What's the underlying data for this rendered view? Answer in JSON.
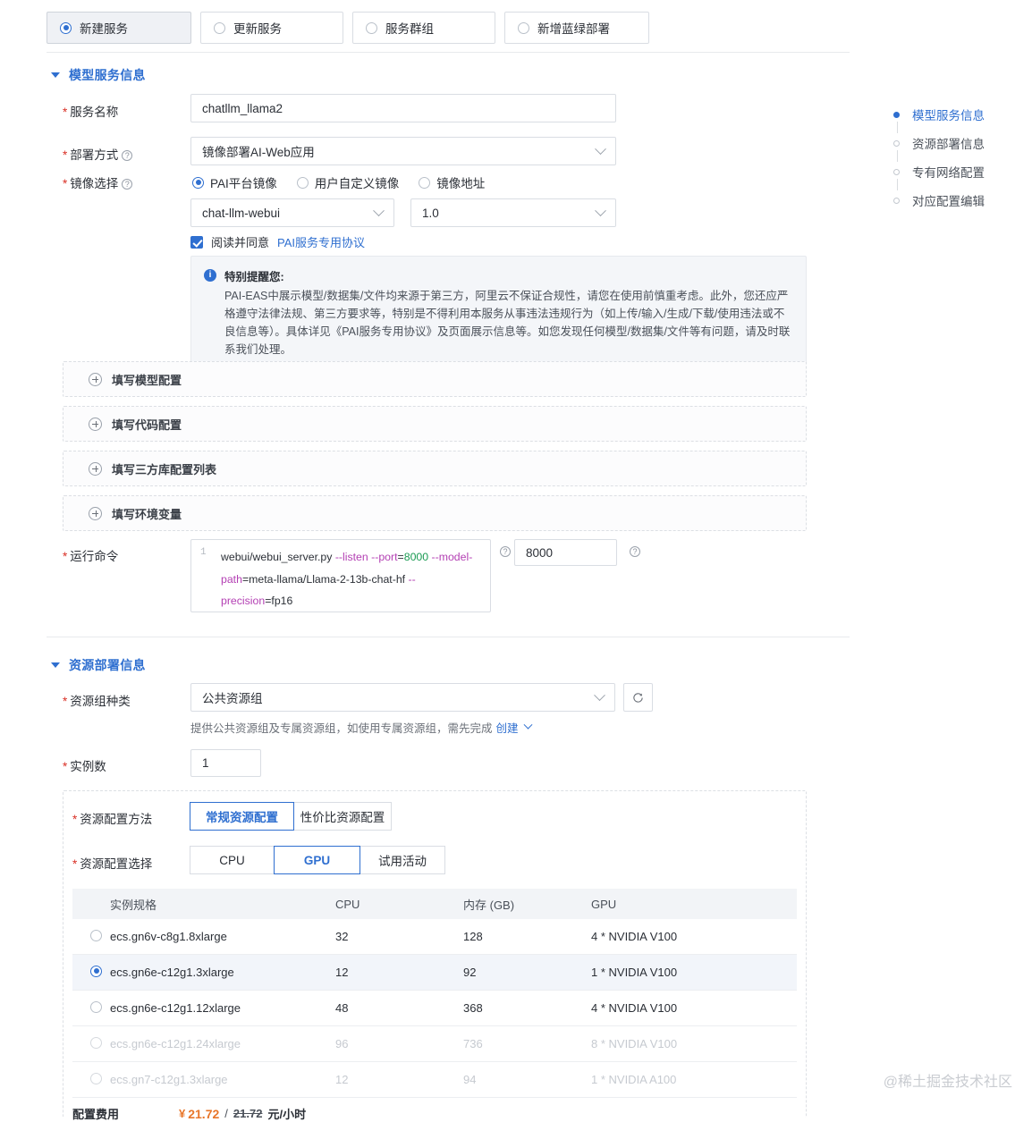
{
  "mode_options": [
    {
      "label": "新建服务",
      "selected": true
    },
    {
      "label": "更新服务",
      "selected": false
    },
    {
      "label": "服务群组",
      "selected": false
    },
    {
      "label": "新增蓝绿部署",
      "selected": false
    }
  ],
  "sections": {
    "model_service": {
      "title": "模型服务信息"
    },
    "resource_deploy": {
      "title": "资源部署信息"
    }
  },
  "form": {
    "service_name": {
      "label": "服务名称",
      "value": "chatllm_llama2"
    },
    "deploy_method": {
      "label": "部署方式",
      "value": "镜像部署AI-Web应用"
    },
    "image_choice": {
      "label": "镜像选择",
      "options": [
        "PAI平台镜像",
        "用户自定义镜像",
        "镜像地址"
      ],
      "selected_index": 0,
      "image_name": "chat-llm-webui",
      "image_version": "1.0"
    },
    "agreement": {
      "text_prefix": "阅读并同意",
      "link": "PAI服务专用协议",
      "checked": true
    },
    "notice": {
      "title": "特别提醒您:",
      "body": "PAI-EAS中展示模型/数据集/文件均来源于第三方，阿里云不保证合规性，请您在使用前慎重考虑。此外，您还应严格遵守法律法规、第三方要求等，特别是不得利用本服务从事违法违规行为（如上传/输入/生成/下载/使用违法或不良信息等）。具体详见《PAI服务专用协议》及页面展示信息等。如您发现任何模型/数据集/文件等有问题，请及时联系我们处理。"
    },
    "add_rows": [
      {
        "label": "填写模型配置"
      },
      {
        "label": "填写代码配置"
      },
      {
        "label": "填写三方库配置列表"
      },
      {
        "label": "填写环境变量"
      }
    ],
    "run_command": {
      "label": "运行命令",
      "line_number": "1",
      "tokens": [
        {
          "text": "webui/webui_server.py ",
          "type": "plain"
        },
        {
          "text": "--listen ",
          "type": "flag"
        },
        {
          "text": "--port",
          "type": "flag"
        },
        {
          "text": "=",
          "type": "plain"
        },
        {
          "text": "8000",
          "type": "num"
        },
        {
          "text": " ",
          "type": "plain"
        },
        {
          "text": "--model-path",
          "type": "flag"
        },
        {
          "text": "=meta-llama/Llama-2-13b-chat-hf ",
          "type": "plain"
        },
        {
          "text": "--precision",
          "type": "flag"
        },
        {
          "text": "=fp16",
          "type": "plain"
        }
      ],
      "port_value": "8000"
    },
    "resource_group": {
      "label": "资源组种类",
      "value": "公共资源组",
      "hint_prefix": "提供公共资源组及专属资源组，如使用专属资源组，需先完成",
      "hint_link": "创建",
      "refresh_icon": "refresh-icon"
    },
    "instance_count": {
      "label": "实例数",
      "value": "1"
    },
    "config_method": {
      "label": "资源配置方法",
      "options": [
        "常规资源配置",
        "性价比资源配置"
      ],
      "selected_index": 0
    },
    "config_choice": {
      "label": "资源配置选择",
      "options": [
        "CPU",
        "GPU",
        "试用活动"
      ],
      "selected_index": 1
    }
  },
  "table": {
    "columns": [
      "实例规格",
      "CPU",
      "内存 (GB)",
      "GPU"
    ],
    "rows": [
      {
        "spec": "ecs.gn6v-c8g1.8xlarge",
        "cpu": "32",
        "mem": "128",
        "gpu": "4 * NVIDIA V100",
        "selected": false,
        "disabled": false
      },
      {
        "spec": "ecs.gn6e-c12g1.3xlarge",
        "cpu": "12",
        "mem": "92",
        "gpu": "1 * NVIDIA V100",
        "selected": true,
        "disabled": false
      },
      {
        "spec": "ecs.gn6e-c12g1.12xlarge",
        "cpu": "48",
        "mem": "368",
        "gpu": "4 * NVIDIA V100",
        "selected": false,
        "disabled": false
      },
      {
        "spec": "ecs.gn6e-c12g1.24xlarge",
        "cpu": "96",
        "mem": "736",
        "gpu": "8 * NVIDIA V100",
        "selected": false,
        "disabled": true
      },
      {
        "spec": "ecs.gn7-c12g1.3xlarge",
        "cpu": "12",
        "mem": "94",
        "gpu": "1 * NVIDIA A100",
        "selected": false,
        "disabled": true
      }
    ]
  },
  "fee": {
    "label": "配置费用",
    "currency": "¥",
    "price": "21.72",
    "separator": "/",
    "original_price": "21.72",
    "unit": "元/小时"
  },
  "right_nav": [
    {
      "label": "模型服务信息",
      "active": true
    },
    {
      "label": "资源部署信息",
      "active": false
    },
    {
      "label": "专有网络配置",
      "active": false
    },
    {
      "label": "对应配置编辑",
      "active": false
    }
  ],
  "watermark": "@稀土掘金技术社区",
  "colors": {
    "accent": "#2f6fd0",
    "required": "#d93026",
    "price": "#e8762a",
    "flag": "#b33fb3",
    "number": "#1a9a52"
  }
}
